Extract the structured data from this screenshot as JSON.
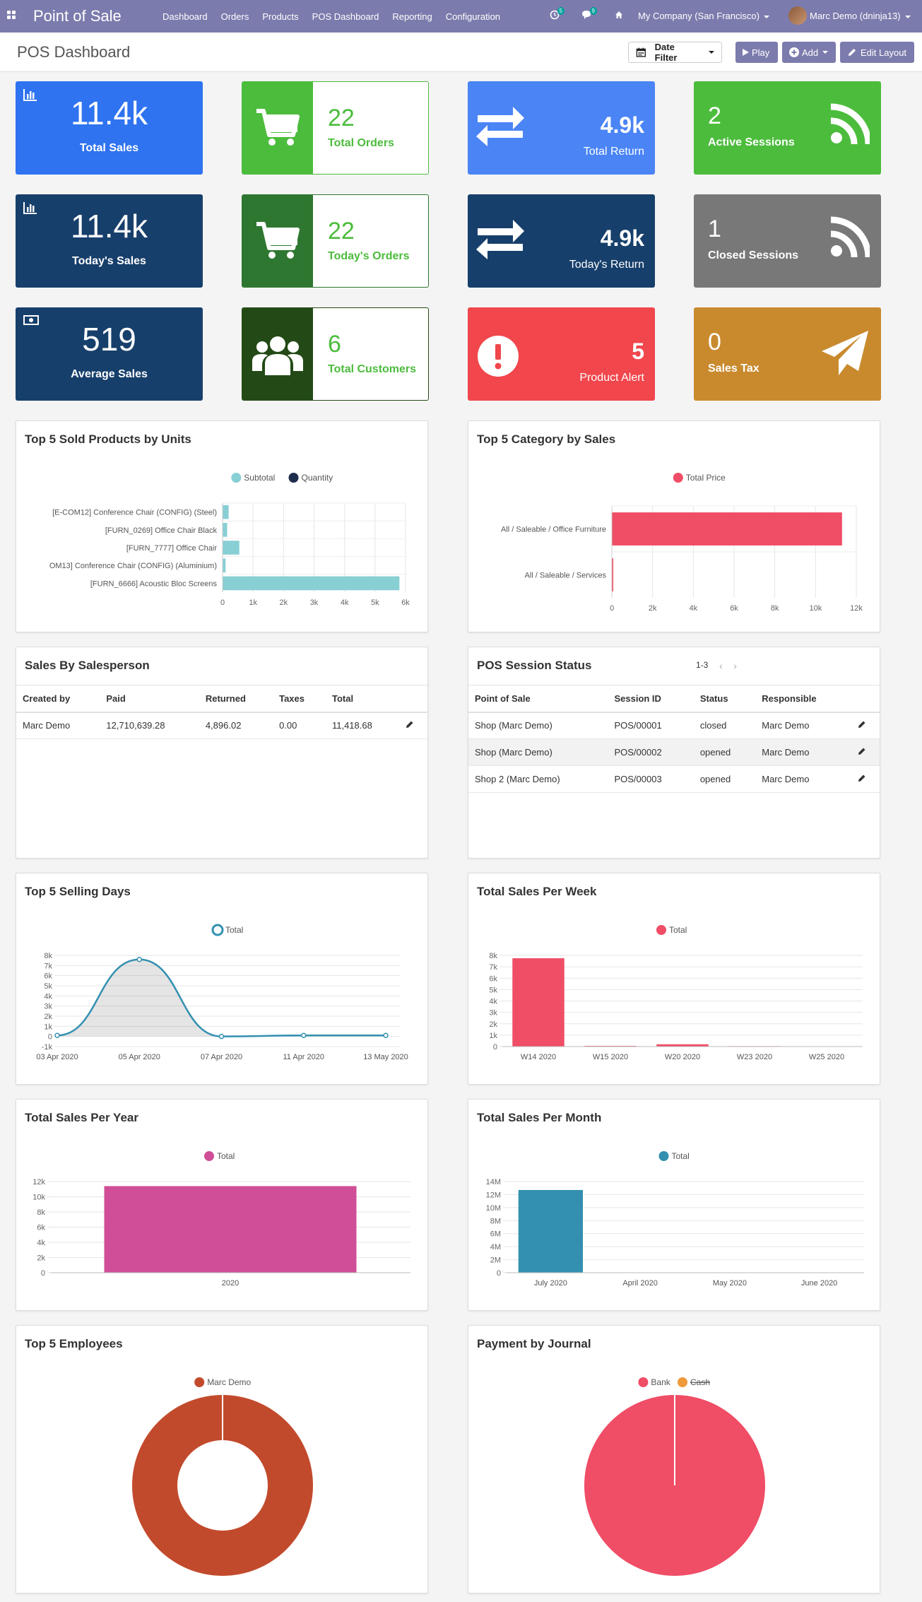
{
  "navbar": {
    "app_name": "Point of Sale",
    "menu": [
      "Dashboard",
      "Orders",
      "Products",
      "POS Dashboard",
      "Reporting",
      "Configuration"
    ],
    "activity_badge": "5",
    "messages_badge": "9",
    "company": "My Company (San Francisco)",
    "user": "Marc Demo (dninja13)"
  },
  "control_panel": {
    "title": "POS Dashboard",
    "date_filter": "Date Filter",
    "play": "Play",
    "add": "Add",
    "edit_layout": "Edit Layout"
  },
  "tiles": {
    "total_sales": {
      "value": "11.4k",
      "label": "Total Sales"
    },
    "total_orders": {
      "value": "22",
      "label": "Total Orders"
    },
    "total_return": {
      "value": "4.9k",
      "label": "Total Return"
    },
    "active_sessions": {
      "value": "2",
      "label": "Active Sessions"
    },
    "todays_sales": {
      "value": "11.4k",
      "label": "Today's Sales"
    },
    "todays_orders": {
      "value": "22",
      "label": "Today's Orders"
    },
    "todays_return": {
      "value": "4.9k",
      "label": "Today's Return"
    },
    "closed_sessions": {
      "value": "1",
      "label": "Closed Sessions"
    },
    "average_sales": {
      "value": "519",
      "label": "Average Sales"
    },
    "total_customers": {
      "value": "6",
      "label": "Total Customers"
    },
    "product_alert": {
      "value": "5",
      "label": "Product Alert"
    },
    "sales_tax": {
      "value": "0",
      "label": "Sales Tax"
    }
  },
  "colors": {
    "navbar": "#7c7bad",
    "blue": "#2f73f0",
    "navy": "#173f6b",
    "green": "#4cbc3c",
    "dark_green": "#2e7730",
    "darker_green": "#234a16",
    "gray": "#787878",
    "red": "#f0464c",
    "orange": "#c98a2e",
    "teal": "#88cfd4",
    "pink": "#f04d66",
    "magenta": "#d04e97",
    "cyan": "#3390b0",
    "rust": "#c24a2c"
  },
  "cards": {
    "top_products": {
      "title": "Top 5 Sold Products by Units"
    },
    "top_category": {
      "title": "Top 5 Category by Sales"
    },
    "salesperson": {
      "title": "Sales By Salesperson",
      "columns": [
        "Created by",
        "Paid",
        "Returned",
        "Taxes",
        "Total"
      ],
      "rows": [
        [
          "Marc Demo",
          "12,710,639.28",
          "4,896.02",
          "0.00",
          "11,418.68"
        ]
      ]
    },
    "session_status": {
      "title": "POS Session Status",
      "pager": "1-3",
      "columns": [
        "Point of Sale",
        "Session ID",
        "Status",
        "Responsible"
      ],
      "rows": [
        [
          "Shop (Marc Demo)",
          "POS/00001",
          "closed",
          "Marc Demo"
        ],
        [
          "Shop (Marc Demo)",
          "POS/00002",
          "opened",
          "Marc Demo"
        ],
        [
          "Shop 2 (Marc Demo)",
          "POS/00003",
          "opened",
          "Marc Demo"
        ]
      ]
    },
    "selling_days": {
      "title": "Top 5 Selling Days"
    },
    "sales_week": {
      "title": "Total Sales Per Week"
    },
    "sales_year": {
      "title": "Total Sales Per Year"
    },
    "sales_month": {
      "title": "Total Sales Per Month"
    },
    "employees": {
      "title": "Top 5 Employees"
    },
    "journal": {
      "title": "Payment by Journal"
    }
  },
  "chart_data": [
    {
      "id": "top_products",
      "type": "bar",
      "orientation": "horizontal",
      "categories": [
        "[E-COM12] Conference Chair (CONFIG) (Steel)",
        "[FURN_0269] Office Chair Black",
        "[FURN_7777] Office Chair",
        "OM13] Conference Chair (CONFIG) (Aluminium)",
        "[FURN_6666] Acoustic Bloc Screens"
      ],
      "series": [
        {
          "name": "Subtotal",
          "color": "#88cfd4",
          "values": [
            200,
            150,
            550,
            100,
            5800
          ]
        },
        {
          "name": "Quantity",
          "color": "#1f2d4d",
          "values": [
            0,
            0,
            0,
            0,
            0
          ]
        }
      ],
      "xlim": [
        0,
        6000
      ],
      "xticks": [
        "0",
        "1k",
        "2k",
        "3k",
        "4k",
        "5k",
        "6k"
      ],
      "legend": "top"
    },
    {
      "id": "top_category",
      "type": "bar",
      "orientation": "horizontal",
      "categories": [
        "All / Saleable / Office Furniture",
        "All / Saleable / Services"
      ],
      "series": [
        {
          "name": "Total Price",
          "color": "#f04d66",
          "values": [
            11300,
            60
          ]
        }
      ],
      "xlim": [
        0,
        12000
      ],
      "xticks": [
        "0",
        "2k",
        "4k",
        "6k",
        "8k",
        "10k",
        "12k"
      ],
      "legend": "top"
    },
    {
      "id": "selling_days",
      "type": "line",
      "x": [
        "03 Apr 2020",
        "05 Apr 2020",
        "07 Apr 2020",
        "11 Apr 2020",
        "13 May 2020"
      ],
      "series": [
        {
          "name": "Total",
          "color": "#3390b0",
          "values": [
            100,
            7600,
            0,
            100,
            100
          ]
        }
      ],
      "ylim": [
        -1000,
        8000
      ],
      "yticks": [
        "-1k",
        "0",
        "1k",
        "2k",
        "3k",
        "4k",
        "5k",
        "6k",
        "7k",
        "8k"
      ],
      "legend": "top"
    },
    {
      "id": "sales_week",
      "type": "bar",
      "categories": [
        "W14 2020",
        "W15 2020",
        "W20 2020",
        "W23 2020",
        "W25 2020"
      ],
      "series": [
        {
          "name": "Total",
          "color": "#f04d66",
          "values": [
            7750,
            60,
            200,
            40,
            20
          ]
        }
      ],
      "ylim": [
        0,
        8000
      ],
      "yticks": [
        "0",
        "1k",
        "2k",
        "3k",
        "4k",
        "5k",
        "6k",
        "7k",
        "8k"
      ],
      "legend": "top"
    },
    {
      "id": "sales_year",
      "type": "bar",
      "categories": [
        "2020"
      ],
      "series": [
        {
          "name": "Total",
          "color": "#d04e97",
          "values": [
            11400
          ]
        }
      ],
      "ylim": [
        0,
        12000
      ],
      "yticks": [
        "0",
        "2k",
        "4k",
        "6k",
        "8k",
        "10k",
        "12k"
      ],
      "legend": "top"
    },
    {
      "id": "sales_month",
      "type": "bar",
      "categories": [
        "July 2020",
        "April 2020",
        "May 2020",
        "June 2020"
      ],
      "series": [
        {
          "name": "Total",
          "color": "#3390b0",
          "values": [
            12700000,
            0,
            0,
            0
          ]
        }
      ],
      "ylim": [
        0,
        14000000
      ],
      "yticks": [
        "0",
        "2M",
        "4M",
        "6M",
        "8M",
        "10M",
        "12M",
        "14M"
      ],
      "legend": "top"
    },
    {
      "id": "employees",
      "type": "pie",
      "donut": true,
      "series": [
        {
          "name": "Marc Demo",
          "color": "#c24a2c",
          "value": 100
        }
      ],
      "legend": "top"
    },
    {
      "id": "journal",
      "type": "pie",
      "series": [
        {
          "name": "Bank",
          "color": "#f04d66",
          "value": 100
        },
        {
          "name": "Cash",
          "color": "#f09a3c",
          "value": 0,
          "hidden": true
        }
      ],
      "legend": "top"
    }
  ]
}
